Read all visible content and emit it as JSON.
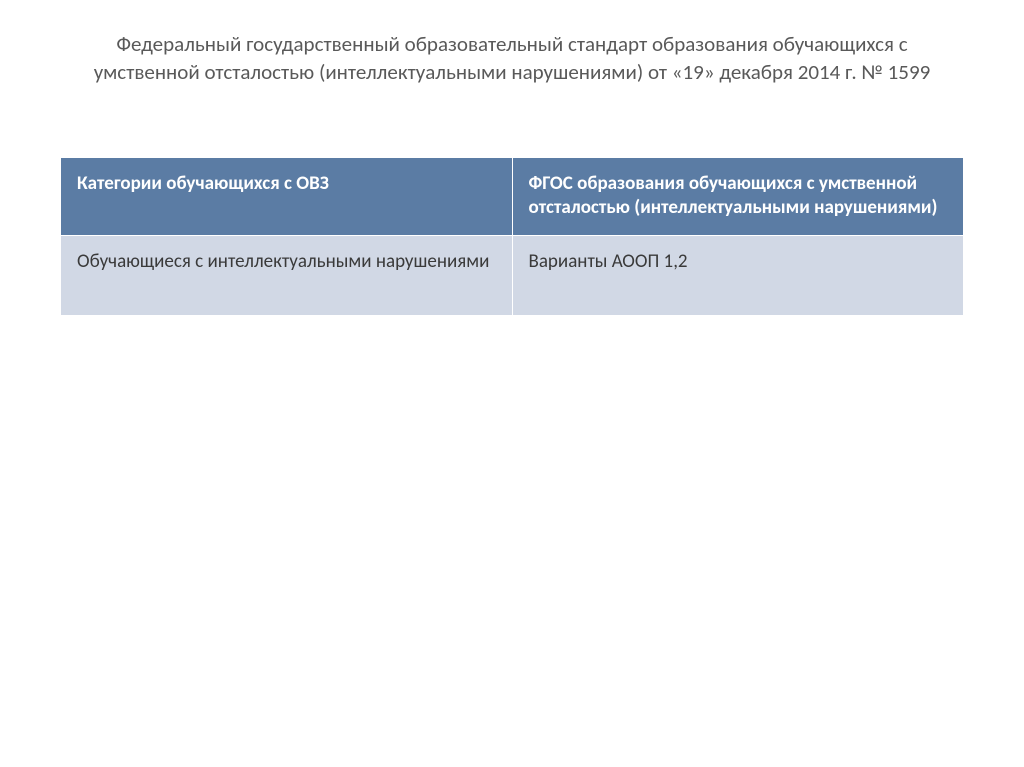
{
  "title": "Федеральный государственный образовательный стандарт образования обучающихся с умственной отсталостью (интеллектуальными нарушениями) от «19» декабря 2014 г. № 1599",
  "table": {
    "headers": [
      "Категории обучающихся с ОВЗ",
      "ФГОС образования обучающихся с умственной отсталостью (интеллектуальными нарушениями)"
    ],
    "rows": [
      {
        "category": "Обучающиеся с интеллектуальными нарушениями",
        "standard": "Варианты  АООП   1,2"
      }
    ]
  },
  "chart_data": {
    "type": "table",
    "title": "Федеральный государственный образовательный стандарт образования обучающихся с умственной отсталостью (интеллектуальными нарушениями) от «19» декабря 2014 г. № 1599",
    "columns": [
      "Категории обучающихся с ОВЗ",
      "ФГОС образования обучающихся с умственной отсталостью (интеллектуальными нарушениями)"
    ],
    "data": [
      [
        "Обучающиеся с интеллектуальными нарушениями",
        "Варианты АООП 1,2"
      ]
    ]
  }
}
